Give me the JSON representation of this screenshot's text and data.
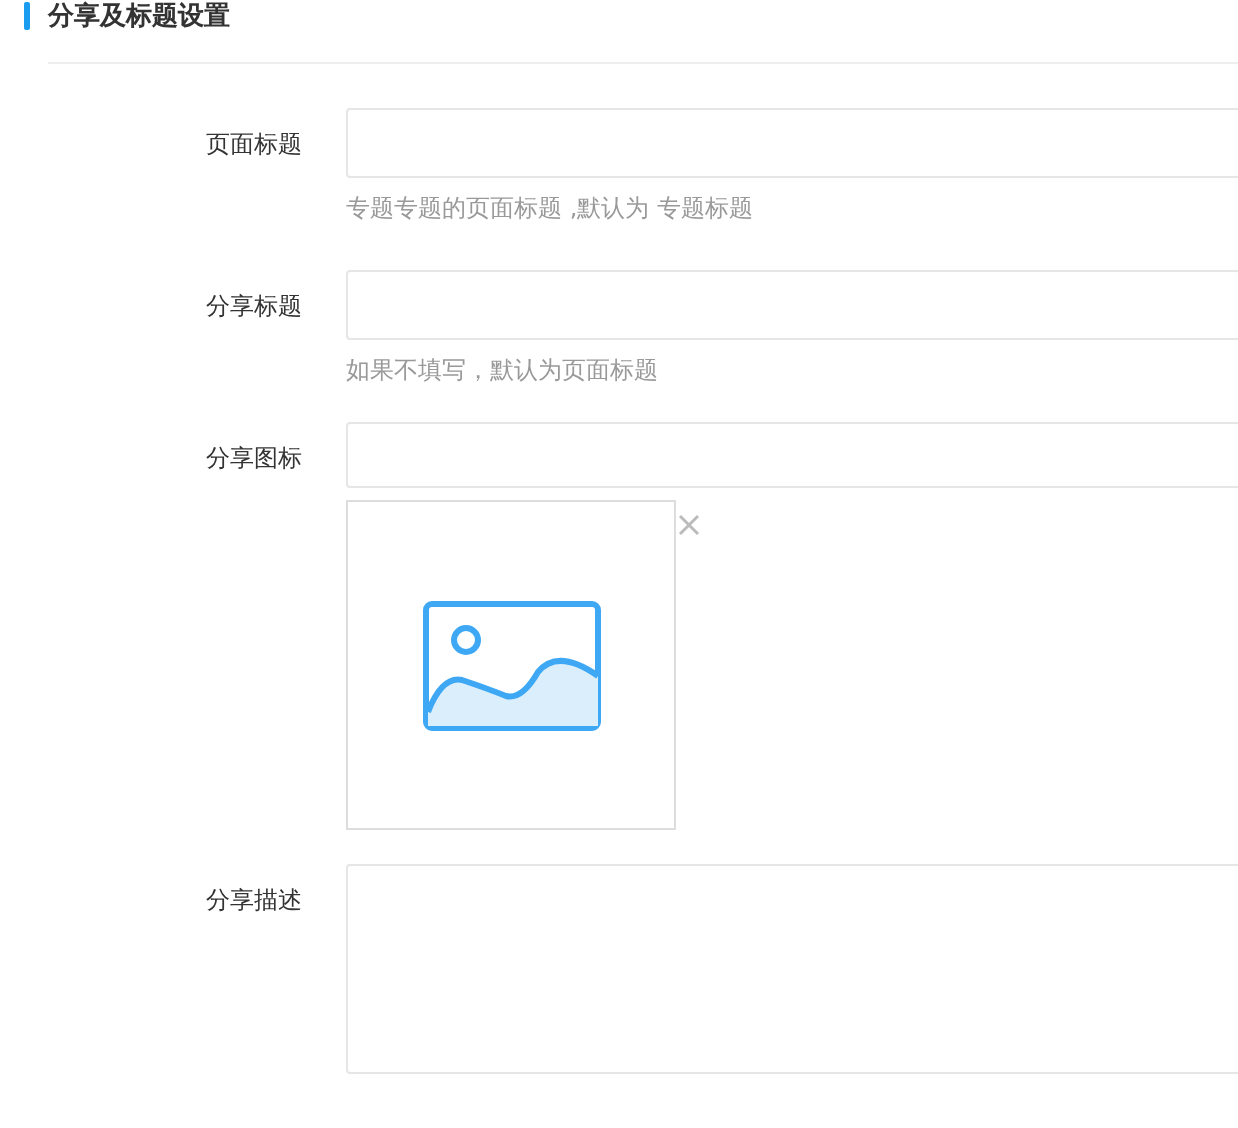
{
  "section": {
    "title": "分享及标题设置"
  },
  "fields": [
    {
      "kind": "input",
      "label": "页面标题",
      "hint": "专题专题的页面标题 ,默认为 专题标题"
    },
    {
      "kind": "input",
      "label": "分享标题",
      "hint": "如果不填写，默认为页面标题"
    },
    {
      "kind": "image",
      "label": "分享图标"
    },
    {
      "kind": "textarea",
      "label": "分享描述"
    }
  ]
}
